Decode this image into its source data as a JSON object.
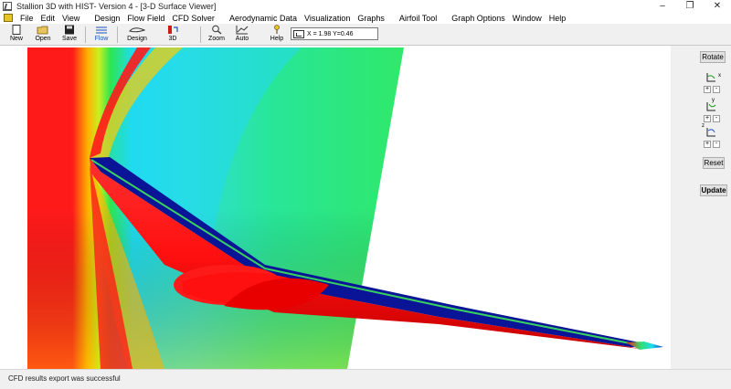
{
  "window": {
    "title": "Stallion 3D with HIST- Version 4 - [3-D Surface Viewer]",
    "controls": [
      "–",
      "❐",
      "✕"
    ]
  },
  "menu": [
    "File",
    "Edit",
    "View",
    "Design",
    "Flow Field",
    "CFD Solver",
    "Aerodynamic Data",
    "Visualization",
    "Graphs",
    "Airfoil Tool",
    "Graph Options",
    "Window",
    "Help"
  ],
  "toolbar": {
    "new": "New",
    "open": "Open",
    "save": "Save",
    "flow": "Flow",
    "design": "Design",
    "3d": "3D",
    "zoom": "Zoom",
    "auto": "Auto",
    "help": "Help",
    "coords": "X = 1.98  Y=0.46"
  },
  "side": {
    "rotate": "Rotate",
    "x_label": "x",
    "y_label": "y",
    "z_label": "z",
    "plus": "+",
    "minus": "-",
    "reset": "Reset",
    "update": "Update"
  },
  "status": "CFD results export was successful",
  "colors": {
    "hot": "#ff1a1a",
    "wing_top": "#0a1496",
    "field_cyan": "#1edcf0",
    "field_green": "#2ee64e"
  }
}
